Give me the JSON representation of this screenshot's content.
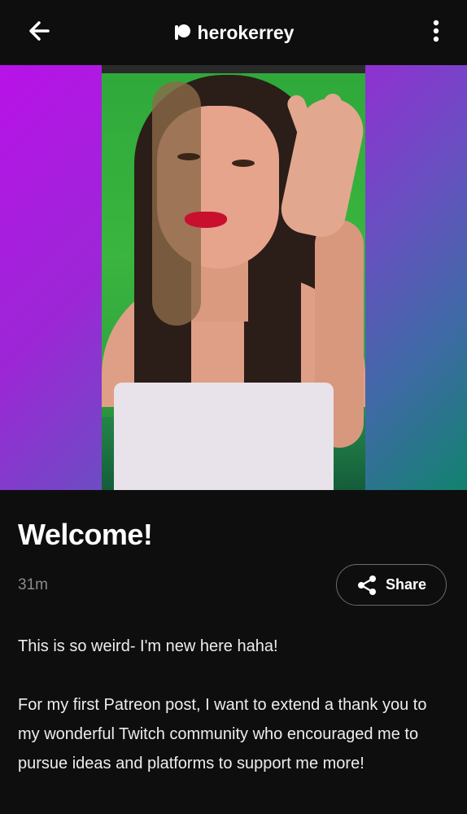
{
  "header": {
    "creator_name": "herokerrey",
    "back_icon": "arrow-left-icon",
    "brand_icon": "patreon-logo-icon",
    "more_icon": "more-vertical-icon"
  },
  "post": {
    "title": "Welcome!",
    "time_ago": "31m",
    "share_label": "Share",
    "share_icon": "share-icon",
    "paragraphs": [
      "This is so weird- I'm new here haha!",
      "For my first Patreon post, I want to extend a thank you to my wonderful Twitch community who encouraged me to pursue ideas and platforms to support me more!"
    ]
  },
  "colors": {
    "background": "#0e0e0e",
    "text": "#ffffff",
    "muted": "#8a8a8a",
    "gradient_start": "#b912e8",
    "gradient_end": "#11826e"
  }
}
